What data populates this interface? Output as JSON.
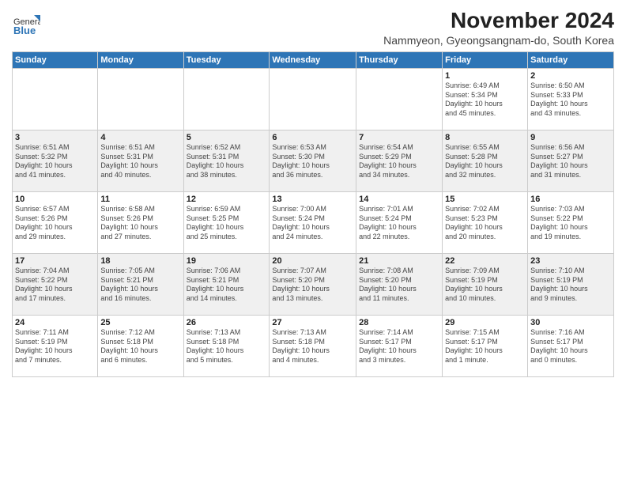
{
  "header": {
    "logo_general": "General",
    "logo_blue": "Blue",
    "title": "November 2024",
    "subtitle": "Nammyeon, Gyeongsangnam-do, South Korea"
  },
  "days_of_week": [
    "Sunday",
    "Monday",
    "Tuesday",
    "Wednesday",
    "Thursday",
    "Friday",
    "Saturday"
  ],
  "weeks": [
    [
      {
        "day": "",
        "info": ""
      },
      {
        "day": "",
        "info": ""
      },
      {
        "day": "",
        "info": ""
      },
      {
        "day": "",
        "info": ""
      },
      {
        "day": "",
        "info": ""
      },
      {
        "day": "1",
        "info": "Sunrise: 6:49 AM\nSunset: 5:34 PM\nDaylight: 10 hours\nand 45 minutes."
      },
      {
        "day": "2",
        "info": "Sunrise: 6:50 AM\nSunset: 5:33 PM\nDaylight: 10 hours\nand 43 minutes."
      }
    ],
    [
      {
        "day": "3",
        "info": "Sunrise: 6:51 AM\nSunset: 5:32 PM\nDaylight: 10 hours\nand 41 minutes."
      },
      {
        "day": "4",
        "info": "Sunrise: 6:51 AM\nSunset: 5:31 PM\nDaylight: 10 hours\nand 40 minutes."
      },
      {
        "day": "5",
        "info": "Sunrise: 6:52 AM\nSunset: 5:31 PM\nDaylight: 10 hours\nand 38 minutes."
      },
      {
        "day": "6",
        "info": "Sunrise: 6:53 AM\nSunset: 5:30 PM\nDaylight: 10 hours\nand 36 minutes."
      },
      {
        "day": "7",
        "info": "Sunrise: 6:54 AM\nSunset: 5:29 PM\nDaylight: 10 hours\nand 34 minutes."
      },
      {
        "day": "8",
        "info": "Sunrise: 6:55 AM\nSunset: 5:28 PM\nDaylight: 10 hours\nand 32 minutes."
      },
      {
        "day": "9",
        "info": "Sunrise: 6:56 AM\nSunset: 5:27 PM\nDaylight: 10 hours\nand 31 minutes."
      }
    ],
    [
      {
        "day": "10",
        "info": "Sunrise: 6:57 AM\nSunset: 5:26 PM\nDaylight: 10 hours\nand 29 minutes."
      },
      {
        "day": "11",
        "info": "Sunrise: 6:58 AM\nSunset: 5:26 PM\nDaylight: 10 hours\nand 27 minutes."
      },
      {
        "day": "12",
        "info": "Sunrise: 6:59 AM\nSunset: 5:25 PM\nDaylight: 10 hours\nand 25 minutes."
      },
      {
        "day": "13",
        "info": "Sunrise: 7:00 AM\nSunset: 5:24 PM\nDaylight: 10 hours\nand 24 minutes."
      },
      {
        "day": "14",
        "info": "Sunrise: 7:01 AM\nSunset: 5:24 PM\nDaylight: 10 hours\nand 22 minutes."
      },
      {
        "day": "15",
        "info": "Sunrise: 7:02 AM\nSunset: 5:23 PM\nDaylight: 10 hours\nand 20 minutes."
      },
      {
        "day": "16",
        "info": "Sunrise: 7:03 AM\nSunset: 5:22 PM\nDaylight: 10 hours\nand 19 minutes."
      }
    ],
    [
      {
        "day": "17",
        "info": "Sunrise: 7:04 AM\nSunset: 5:22 PM\nDaylight: 10 hours\nand 17 minutes."
      },
      {
        "day": "18",
        "info": "Sunrise: 7:05 AM\nSunset: 5:21 PM\nDaylight: 10 hours\nand 16 minutes."
      },
      {
        "day": "19",
        "info": "Sunrise: 7:06 AM\nSunset: 5:21 PM\nDaylight: 10 hours\nand 14 minutes."
      },
      {
        "day": "20",
        "info": "Sunrise: 7:07 AM\nSunset: 5:20 PM\nDaylight: 10 hours\nand 13 minutes."
      },
      {
        "day": "21",
        "info": "Sunrise: 7:08 AM\nSunset: 5:20 PM\nDaylight: 10 hours\nand 11 minutes."
      },
      {
        "day": "22",
        "info": "Sunrise: 7:09 AM\nSunset: 5:19 PM\nDaylight: 10 hours\nand 10 minutes."
      },
      {
        "day": "23",
        "info": "Sunrise: 7:10 AM\nSunset: 5:19 PM\nDaylight: 10 hours\nand 9 minutes."
      }
    ],
    [
      {
        "day": "24",
        "info": "Sunrise: 7:11 AM\nSunset: 5:19 PM\nDaylight: 10 hours\nand 7 minutes."
      },
      {
        "day": "25",
        "info": "Sunrise: 7:12 AM\nSunset: 5:18 PM\nDaylight: 10 hours\nand 6 minutes."
      },
      {
        "day": "26",
        "info": "Sunrise: 7:13 AM\nSunset: 5:18 PM\nDaylight: 10 hours\nand 5 minutes."
      },
      {
        "day": "27",
        "info": "Sunrise: 7:13 AM\nSunset: 5:18 PM\nDaylight: 10 hours\nand 4 minutes."
      },
      {
        "day": "28",
        "info": "Sunrise: 7:14 AM\nSunset: 5:17 PM\nDaylight: 10 hours\nand 3 minutes."
      },
      {
        "day": "29",
        "info": "Sunrise: 7:15 AM\nSunset: 5:17 PM\nDaylight: 10 hours\nand 1 minute."
      },
      {
        "day": "30",
        "info": "Sunrise: 7:16 AM\nSunset: 5:17 PM\nDaylight: 10 hours\nand 0 minutes."
      }
    ]
  ]
}
